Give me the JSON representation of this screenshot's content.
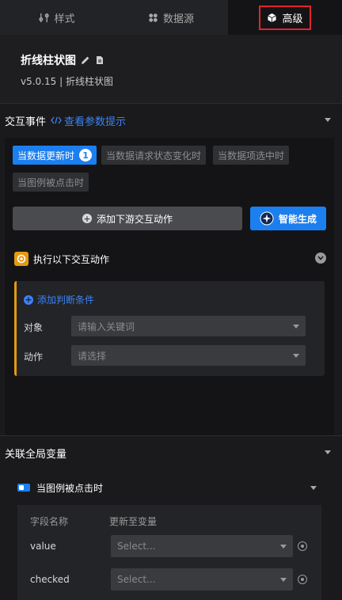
{
  "tabs": [
    {
      "label": "样式",
      "icon": "style-sliders-icon"
    },
    {
      "label": "数据源",
      "icon": "datasource-icon"
    },
    {
      "label": "高级",
      "icon": "advanced-cube-icon",
      "active": true
    }
  ],
  "component": {
    "title": "折线柱状图",
    "subtitle": "v5.0.15 | 折线柱状图"
  },
  "interaction": {
    "section_title": "交互事件",
    "link_label": "查看参数提示",
    "events": [
      {
        "label": "当数据更新时",
        "badge": "1",
        "active": true
      },
      {
        "label": "当数据请求状态变化时"
      },
      {
        "label": "当数据项选中时"
      },
      {
        "label": "当图例被点击时"
      }
    ],
    "add_button": "添加下游交互动作",
    "ai_button": "智能生成",
    "exec_label": "执行以下交互动作",
    "add_condition": "添加判断条件",
    "object_label": "对象",
    "object_placeholder": "请输入关键词",
    "action_label": "动作",
    "action_placeholder": "请选择"
  },
  "global_vars": {
    "section_title": "关联全局变量",
    "sub_title": "当图例被点击时",
    "col_field": "字段名称",
    "col_update": "更新至变量",
    "rows": [
      {
        "field": "value",
        "placeholder": "Select..."
      },
      {
        "field": "checked",
        "placeholder": "Select..."
      }
    ]
  },
  "colors": {
    "accent": "#1c7ff0",
    "highlight_border": "#e0252d",
    "exec_icon": "#e39a12"
  }
}
